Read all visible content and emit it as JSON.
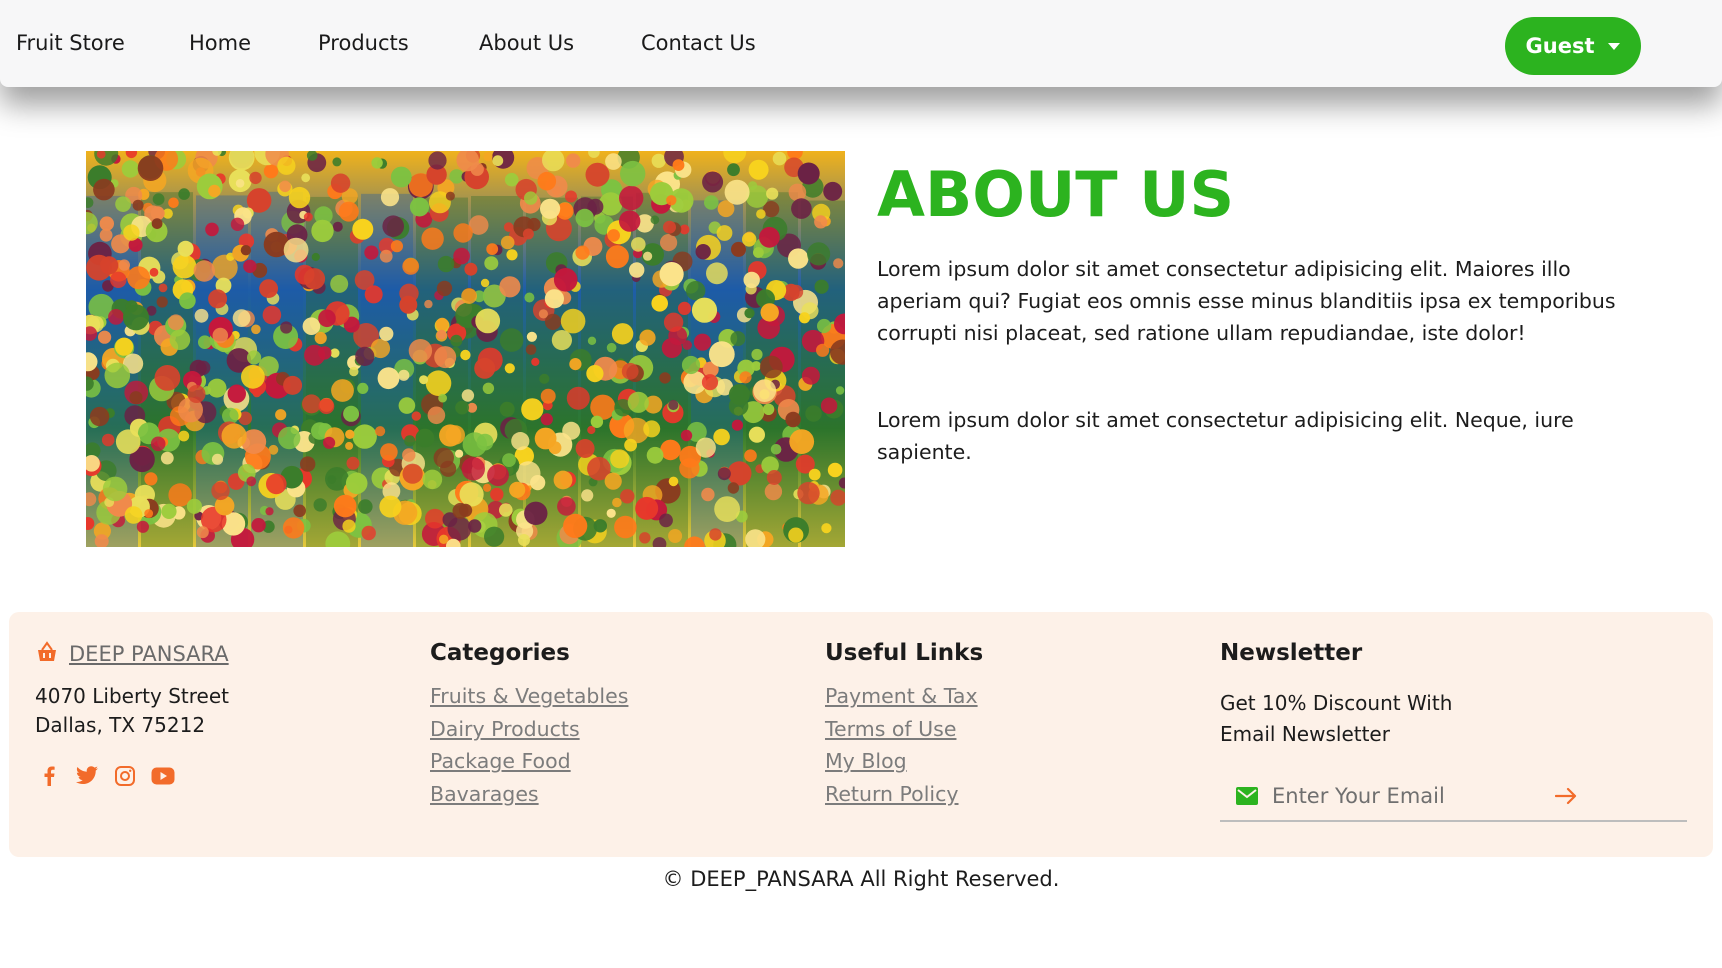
{
  "nav": {
    "brand": "Fruit Store",
    "links": [
      "Home",
      "Products",
      "About Us",
      "Contact Us"
    ],
    "user_button": "Guest"
  },
  "about": {
    "title": "ABOUT US",
    "paragraphs": [
      "Lorem ipsum dolor sit amet consectetur adipisicing elit. Maiores illo aperiam qui? Fugiat eos omnis esse minus blanditiis ipsa ex temporibus corrupti nisi placeat, sed ratione ullam repudiandae, iste dolor!",
      "Lorem ipsum dolor sit amet consectetur adipisicing elit. Neque, iure sapiente."
    ],
    "image": "fruit-market-stall"
  },
  "footer": {
    "brand": "DEEP PANSARA",
    "address_line1": "4070 Liberty Street",
    "address_line2": "Dallas, TX 75212",
    "social_icons": [
      "facebook-icon",
      "twitter-icon",
      "instagram-icon",
      "youtube-icon"
    ],
    "categories": {
      "title": "Categories",
      "links": [
        "Fruits & Vegetables",
        "Dairy Products",
        "Package Food",
        "Bavarages"
      ]
    },
    "useful_links": {
      "title": "Useful Links",
      "links": [
        "Payment & Tax",
        "Terms of Use",
        "My Blog",
        "Return Policy"
      ]
    },
    "newsletter": {
      "title": "Newsletter",
      "text_line1": "Get 10% Discount With",
      "text_line2": "Email Newsletter",
      "placeholder": "Enter Your Email"
    },
    "copyright": "© DEEP_PANSARA All Right Reserved."
  },
  "colors": {
    "accent_green": "#2cb31f",
    "icon_orange": "#f26b2a",
    "footer_bg": "#fdf1e8",
    "navbar_bg": "#f7f7f8"
  }
}
